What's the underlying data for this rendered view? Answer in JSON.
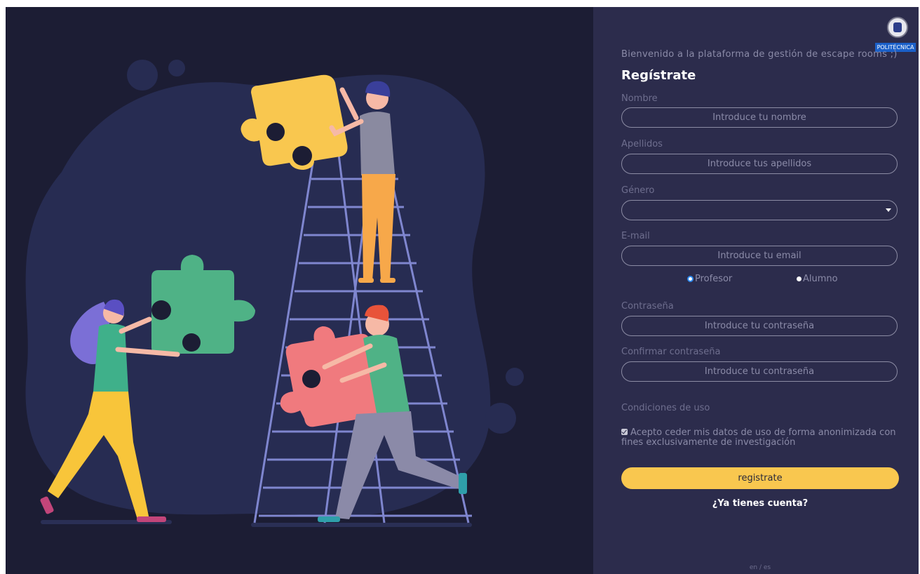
{
  "logo": {
    "text": "POLITÉCNICA"
  },
  "panel": {
    "welcome": "Bienvenido a la plataforma de gestión de escape rooms ;)",
    "title": "Regístrate",
    "fields": {
      "nombre": {
        "label": "Nombre",
        "placeholder": "Introduce tu nombre"
      },
      "apellidos": {
        "label": "Apellidos",
        "placeholder": "Introduce tus apellidos"
      },
      "genero": {
        "label": "Género",
        "value": ""
      },
      "email": {
        "label": "E-mail",
        "placeholder": "Introduce tu email"
      },
      "password": {
        "label": "Contraseña",
        "placeholder": "Introduce tu contraseña"
      },
      "confirm": {
        "label": "Confirmar contraseña",
        "placeholder": "Introduce tu contraseña"
      }
    },
    "roles": [
      {
        "label": "Profesor",
        "selected": true
      },
      {
        "label": "Alumno",
        "selected": false
      }
    ],
    "terms": {
      "heading": "Condiciones de uso",
      "checkbox": "Acepto ceder mis datos de uso de forma anonimizada con fines exclusivamente de investigación",
      "checked": true
    },
    "submit": "registrate",
    "login_link": "¿Ya tienes cuenta?",
    "language": "en / es"
  },
  "colors": {
    "panel_bg": "#2c2c4c",
    "illustration_bg": "#1c1d34",
    "accent": "#f9c74f",
    "radio_selected": "#2f8bf0"
  },
  "icons": [
    "upm-seal-icon",
    "chevron-down-icon",
    "checkbox-checked-icon"
  ]
}
